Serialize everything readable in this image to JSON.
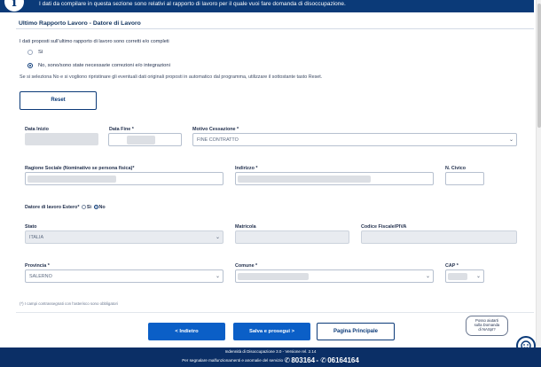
{
  "banner": {
    "icon": "info-icon",
    "text": "I dati da compilare in questa sezione sono relativi al rapporto di lavoro per il quale vuoi fare domanda di disoccupazione."
  },
  "section": {
    "title": "Ultimo Rapporto Lavoro - Datore di Lavoro",
    "question": "I dati proposti sull'ultimo rapporto di lavoro sono corretti e/o completi",
    "option_yes": "Sì",
    "option_no": "No, sono/sono state necessarie correzioni e/o integrazioni",
    "selected": "No",
    "hint": "Se si seleziona No e si vogliono ripristinare gli eventuali dati originali proposti in automatico dal programma, utilizzare il sottostante tasto Reset.",
    "reset_label": "Reset"
  },
  "form": {
    "data_inizio": {
      "label": "Data Inizio",
      "value": ""
    },
    "data_fine": {
      "label": "Data Fine *",
      "value": ""
    },
    "motivo": {
      "label": "Motivo Cessazione *",
      "value": "FINE CONTRATTO"
    },
    "ragione_sociale": {
      "label": "Ragione Sociale (Nominativo se persona fisica)*",
      "value": ""
    },
    "indirizzo": {
      "label": "Indirizzo *",
      "value": ""
    },
    "civico": {
      "label": "N. Civico",
      "value": ""
    },
    "estero": {
      "label": "Datore di lavoro Estero*",
      "opt_si": "Sì",
      "opt_no": "No",
      "selected": "No"
    },
    "stato": {
      "label": "Stato",
      "value": "ITALIA"
    },
    "matricola": {
      "label": "Matricola",
      "value": ""
    },
    "codice_fiscale": {
      "label": "Codice Fiscale/PIVA",
      "value": ""
    },
    "provincia": {
      "label": "Provincia *",
      "value": "SALERNO"
    },
    "comune": {
      "label": "Comune *",
      "value": ""
    },
    "cap": {
      "label": "CAP *",
      "value": ""
    },
    "mandatory_note": "(*) I campi contrassegnati con l'asterisco sono obbligatori"
  },
  "actions": {
    "back": "< Indietro",
    "save": "Salva e prosegui >",
    "home": "Pagina Principale"
  },
  "help": {
    "text_line1": "Posso aiutarti",
    "text_line2": "sulla Domanda",
    "text_line3": "di NASpI?",
    "icon": "chatbot-icon"
  },
  "footer": {
    "line1": "Indennità di Disoccupazione 3.0 - Versione rel. 2.14",
    "line2_prefix": "Per segnalare malfunzionamenti e anomalie del servizio",
    "phone1": "803164",
    "phone2": "06164164"
  },
  "colors": {
    "primary": "#0b3a78",
    "button": "#0b5fc7",
    "footer": "#0b2f66"
  }
}
